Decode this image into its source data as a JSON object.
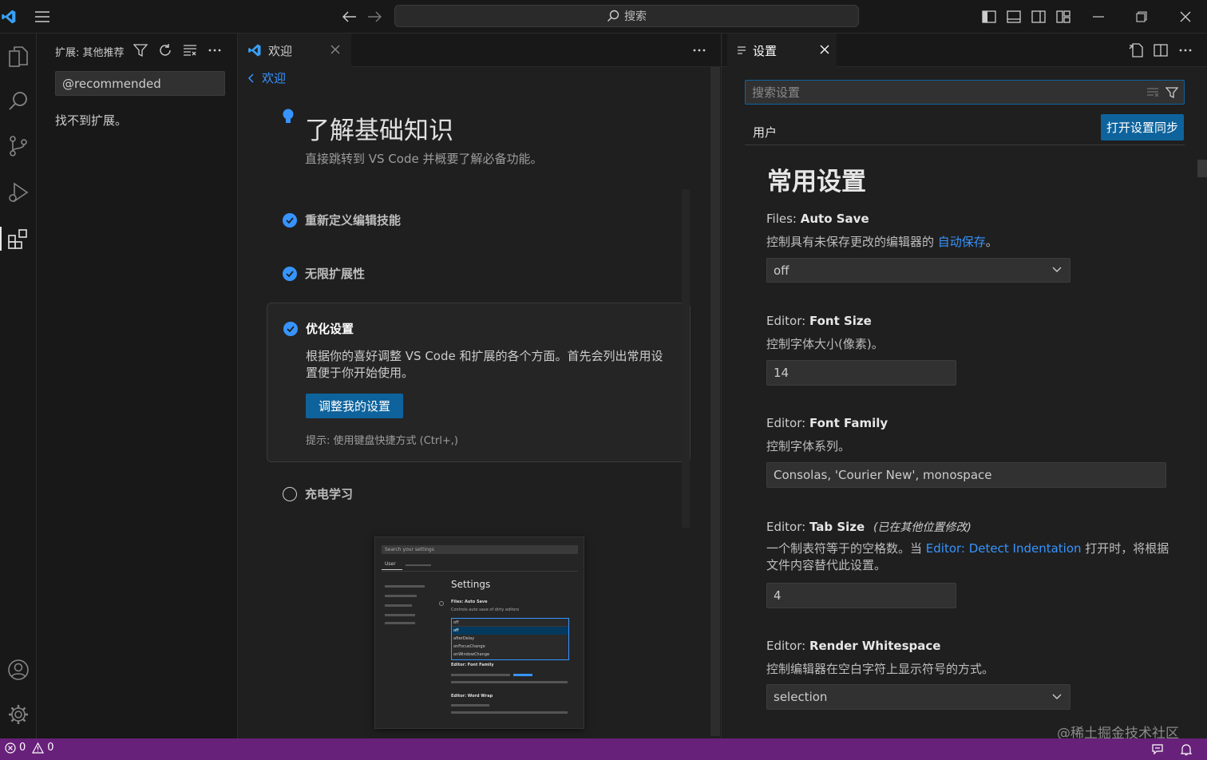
{
  "titlebar": {
    "search_label": "搜索"
  },
  "sidebar": {
    "header_title": "扩展: 其他推荐",
    "search_value": "@recommended",
    "empty_message": "找不到扩展。"
  },
  "welcome_editor": {
    "tab_label": "欢迎",
    "back_label": "欢迎",
    "heading": "了解基础知识",
    "subtitle": "直接跳转到 VS Code 并概要了解必备功能。",
    "steps": [
      {
        "label": "重新定义编辑技能",
        "done": true
      },
      {
        "label": "无限扩展性",
        "done": true
      },
      {
        "label": "优化设置",
        "done": true,
        "expanded": true
      },
      {
        "label": "充电学习",
        "done": false
      }
    ],
    "expanded_step": {
      "description": "根据你的喜好调整 VS Code 和扩展的各个方面。首先会列出常用设置便于你开始使用。",
      "button_label": "调整我的设置",
      "tip": "提示: 使用键盘快捷方式 (Ctrl+,)"
    },
    "preview": {
      "search_placeholder": "Search your settings",
      "tab_user": "User",
      "title": "Settings",
      "files_auto_save_title": "Files: Auto Save",
      "files_auto_save_desc": "Controls auto save of dirty editors",
      "dropdown_value": "off",
      "dropdown_options": [
        "off",
        "afterDelay",
        "onFocusChange",
        "onWindowChange"
      ],
      "font_family_title": "Editor: Font Family",
      "word_wrap_title": "Editor: Word Wrap"
    }
  },
  "settings_editor": {
    "tab_label": "设置",
    "search_placeholder": "搜索设置",
    "scope_tab": "用户",
    "sync_button": "打开设置同步",
    "section_title": "常用设置",
    "items": {
      "auto_save": {
        "category": "Files: ",
        "name": "Auto Save",
        "desc_prefix": "控制具有未保存更改的编辑器的 ",
        "desc_link": "自动保存",
        "desc_suffix": "。",
        "value": "off"
      },
      "font_size": {
        "category": "Editor: ",
        "name": "Font Size",
        "desc": "控制字体大小(像素)。",
        "value": "14"
      },
      "font_family": {
        "category": "Editor: ",
        "name": "Font Family",
        "desc": "控制字体系列。",
        "value": "Consolas, 'Courier New', monospace"
      },
      "tab_size": {
        "category": "Editor: ",
        "name": "Tab Size",
        "modified_note": "(已在其他位置修改)",
        "desc_prefix": "一个制表符等于的空格数。当 ",
        "desc_link": "Editor: Detect Indentation",
        "desc_suffix": " 打开时，将根据文件内容替代此设置。",
        "value": "4"
      },
      "render_whitespace": {
        "category": "Editor: ",
        "name": "Render Whitespace",
        "desc": "控制编辑器在空白字符上显示符号的方式。",
        "value": "selection"
      }
    }
  },
  "statusbar": {
    "errors": "0",
    "warnings": "0"
  },
  "watermark": "@稀土掘金技术社区",
  "colors": {
    "accent": "#0e639c",
    "link": "#3794ff",
    "statusbar": "#68217a",
    "vscode_logo": "#3aa0f3"
  }
}
